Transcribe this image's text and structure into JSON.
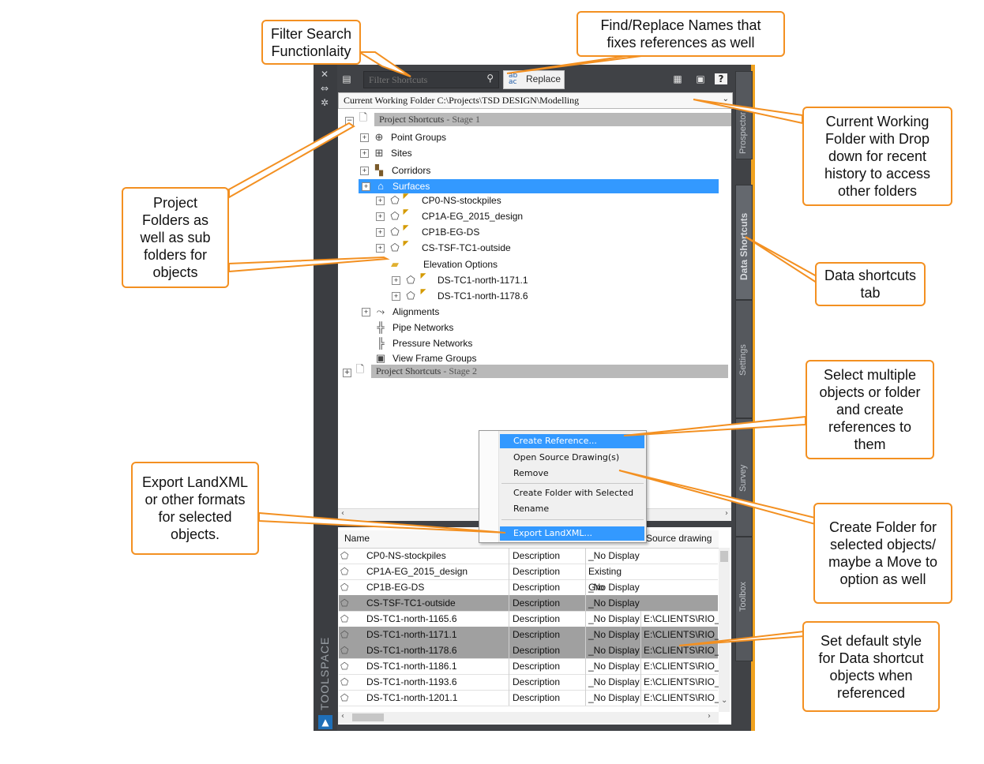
{
  "toolspace": {
    "title": "TOOLSPACE",
    "strip_icons": [
      "close-icon",
      "auto-hide-icon",
      "properties-icon"
    ]
  },
  "toolbar": {
    "filter_placeholder": "Filter Shortcuts",
    "replace_label": "Replace",
    "replace_icon_text": "ab ac"
  },
  "working_folder": {
    "text": "Current Working Folder C:\\Projects\\TSD DESIGN\\Modelling"
  },
  "tree": {
    "stage1_label": "Project Shortcuts",
    "stage1_suffix": " - Stage 1",
    "stage2_label": "Project Shortcuts",
    "stage2_suffix": " - Stage 2",
    "items": {
      "point_groups": "Point Groups",
      "sites": "Sites",
      "corridors": "Corridors",
      "surfaces": "Surfaces",
      "s1": "CP0-NS-stockpiles",
      "s2": "CP1A-EG_2015_design",
      "s3": "CP1B-EG-DS",
      "s4": "CS-TSF-TC1-outside",
      "elevation_options": "Elevation Options",
      "e1": "DS-TC1-north-1171.1",
      "e2": "DS-TC1-north-1178.6",
      "alignments": "Alignments",
      "pipe_networks": "Pipe Networks",
      "pressure_networks": "Pressure Networks",
      "view_frame_groups": "View Frame Groups"
    }
  },
  "tabs": {
    "prospector": "Prospector",
    "data_shortcuts": "Data Shortcuts",
    "settings": "Settings",
    "survey": "Survey",
    "toolbox": "Toolbox"
  },
  "list": {
    "headers": {
      "name": "Name",
      "source_drawing": "Source drawing"
    },
    "rows": [
      {
        "name": "CP0-NS-stockpiles",
        "desc": "Description",
        "style": "_No Display",
        "source": ""
      },
      {
        "name": "CP1A-EG_2015_design",
        "desc": "Description",
        "style": "Existing Gro",
        "source": ""
      },
      {
        "name": "CP1B-EG-DS",
        "desc": "Description",
        "style": "_No Display",
        "source": ""
      },
      {
        "name": "CS-TSF-TC1-outside",
        "desc": "Description",
        "style": "_No Display",
        "source": ""
      },
      {
        "name": "DS-TC1-north-1165.6",
        "desc": "Description",
        "style": "_No Display",
        "source": "E:\\CLIENTS\\RIO_T"
      },
      {
        "name": "DS-TC1-north-1171.1",
        "desc": "Description",
        "style": "_No Display",
        "source": "E:\\CLIENTS\\RIO_T"
      },
      {
        "name": "DS-TC1-north-1178.6",
        "desc": "Description",
        "style": "_No Display",
        "source": "E:\\CLIENTS\\RIO_T"
      },
      {
        "name": "DS-TC1-north-1186.1",
        "desc": "Description",
        "style": "_No Display",
        "source": "E:\\CLIENTS\\RIO_T"
      },
      {
        "name": "DS-TC1-north-1193.6",
        "desc": "Description",
        "style": "_No Display",
        "source": "E:\\CLIENTS\\RIO_T"
      },
      {
        "name": "DS-TC1-north-1201.1",
        "desc": "Description",
        "style": "_No Display",
        "source": "E:\\CLIENTS\\RIO_T"
      }
    ]
  },
  "context_menu": {
    "items": [
      "Create Reference...",
      "Open Source Drawing(s)",
      "Remove",
      "Create Folder with Selected",
      "Rename",
      "Export LandXML..."
    ]
  },
  "annotations": {
    "filter": "Filter Search Functionlaity",
    "find_replace": "Find/Replace Names that fixes references as well",
    "working_folder": "Current Working Folder with Drop down for recent history to access other folders",
    "project_folders": "Project Folders as well as sub folders for objects",
    "data_shortcuts_tab": "Data shortcuts tab",
    "select_multiple": "Select multiple objects or folder and create references to them",
    "export": "Export LandXML or other formats for selected objects.",
    "create_folder": "Create Folder for selected objects/ maybe a Move to option as well",
    "default_style": "Set default style for Data shortcut objects when referenced"
  },
  "colors": {
    "accent_orange": "#f39021",
    "selection_blue": "#3399ff",
    "panel_dark": "#404246"
  }
}
